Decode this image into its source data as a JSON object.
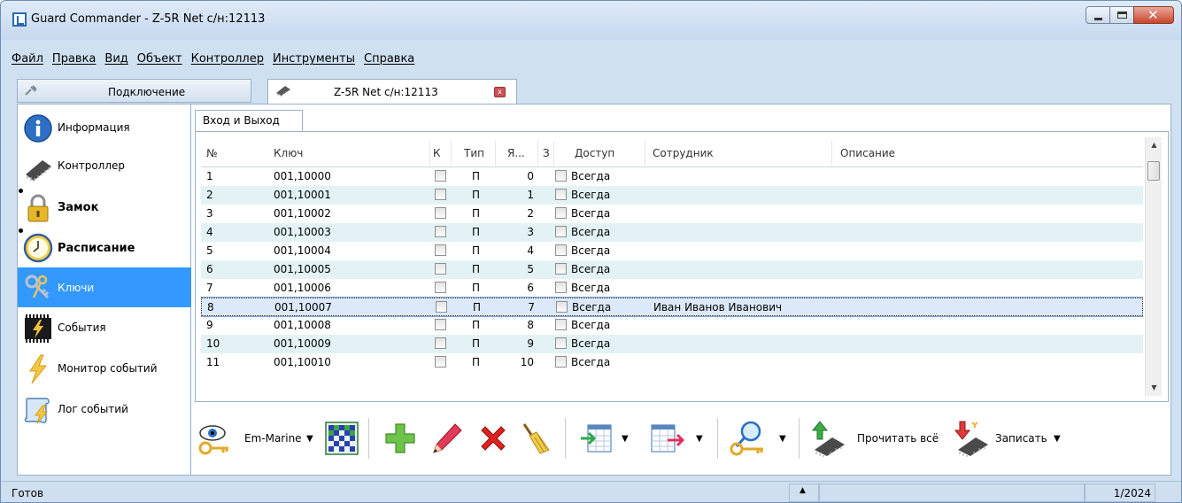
{
  "window": {
    "title": "Guard Commander - Z-5R Net с/н:12113",
    "close_glyph": "✕"
  },
  "menu": [
    {
      "label": "Файл"
    },
    {
      "label": "Правка"
    },
    {
      "label": "Вид"
    },
    {
      "label": "Объект"
    },
    {
      "label": "Контроллер"
    },
    {
      "label": "Инструменты"
    },
    {
      "label": "Справка"
    }
  ],
  "doc_tabs": {
    "connection_label": "Подключение",
    "device_label": "Z-5R Net с/н:12113",
    "device_close_glyph": "x"
  },
  "nav": [
    {
      "label": "Информация",
      "icon": "info-icon",
      "bold": false,
      "marked": false
    },
    {
      "label": "Контроллер",
      "icon": "controller-chip-icon",
      "bold": false,
      "marked": false
    },
    {
      "label": "Замок",
      "icon": "lock-icon",
      "bold": true,
      "marked": true
    },
    {
      "label": "Расписание",
      "icon": "clock-icon",
      "bold": true,
      "marked": true
    },
    {
      "label": "Ключи",
      "icon": "keys-icon",
      "bold": false,
      "marked": false,
      "active": true
    },
    {
      "label": "События",
      "icon": "events-chip-icon",
      "bold": false,
      "marked": false
    },
    {
      "label": "Монитор событий",
      "icon": "lightning-icon",
      "bold": false,
      "marked": false
    },
    {
      "label": "Лог событий",
      "icon": "log-scroll-icon",
      "bold": false,
      "marked": false
    }
  ],
  "inner_tab": "Вход и Выход",
  "table": {
    "headers": {
      "num": "№",
      "key": "Ключ",
      "k": "К",
      "type": "Тип",
      "cell": "Я...",
      "z": "З",
      "access": "Доступ",
      "employee": "Сотрудник",
      "description": "Описание"
    },
    "rows": [
      {
        "num": "1",
        "key": "001,10000",
        "type": "П",
        "cell": "0",
        "access": "Всегда",
        "employee": "",
        "description": ""
      },
      {
        "num": "2",
        "key": "001,10001",
        "type": "П",
        "cell": "1",
        "access": "Всегда",
        "employee": "",
        "description": ""
      },
      {
        "num": "3",
        "key": "001,10002",
        "type": "П",
        "cell": "2",
        "access": "Всегда",
        "employee": "",
        "description": ""
      },
      {
        "num": "4",
        "key": "001,10003",
        "type": "П",
        "cell": "3",
        "access": "Всегда",
        "employee": "",
        "description": ""
      },
      {
        "num": "5",
        "key": "001,10004",
        "type": "П",
        "cell": "4",
        "access": "Всегда",
        "employee": "",
        "description": ""
      },
      {
        "num": "6",
        "key": "001,10005",
        "type": "П",
        "cell": "5",
        "access": "Всегда",
        "employee": "",
        "description": ""
      },
      {
        "num": "7",
        "key": "001,10006",
        "type": "П",
        "cell": "6",
        "access": "Всегда",
        "employee": "",
        "description": ""
      },
      {
        "num": "8",
        "key": "001,10007",
        "type": "П",
        "cell": "7",
        "access": "Всегда",
        "employee": "Иван Иванов Иванович",
        "description": "",
        "selected": true
      },
      {
        "num": "9",
        "key": "001,10008",
        "type": "П",
        "cell": "8",
        "access": "Всегда",
        "employee": "",
        "description": ""
      },
      {
        "num": "10",
        "key": "001,10009",
        "type": "П",
        "cell": "9",
        "access": "Всегда",
        "employee": "",
        "description": ""
      },
      {
        "num": "11",
        "key": "001,10010",
        "type": "П",
        "cell": "10",
        "access": "Всегда",
        "employee": "",
        "description": ""
      }
    ]
  },
  "scrollbar": {
    "up": "▲",
    "down": "▼"
  },
  "toolbar": {
    "key_type_label": "Em-Marine",
    "read_all_label": "Прочитать всё",
    "write_label": "Записать",
    "dropdown_glyph": "▼"
  },
  "status": {
    "text": "Готов",
    "arrow": "▲",
    "count": "1/2024"
  },
  "colors": {
    "selection": "#3399ff",
    "alt_row": "#e3f3f5",
    "chrome": "#cfe0f1"
  }
}
